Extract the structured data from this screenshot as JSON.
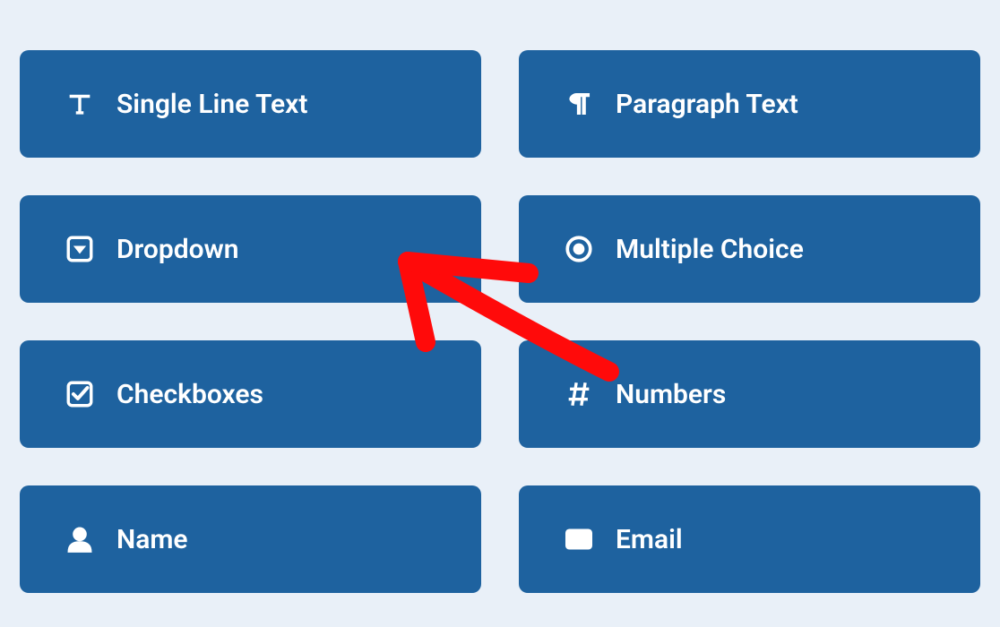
{
  "fields": [
    {
      "label": "Single Line Text",
      "icon": "text-cursor-icon"
    },
    {
      "label": "Paragraph Text",
      "icon": "paragraph-icon"
    },
    {
      "label": "Dropdown",
      "icon": "dropdown-icon"
    },
    {
      "label": "Multiple Choice",
      "icon": "radio-icon"
    },
    {
      "label": "Checkboxes",
      "icon": "checkbox-icon"
    },
    {
      "label": "Numbers",
      "icon": "hash-icon"
    },
    {
      "label": "Name",
      "icon": "user-icon"
    },
    {
      "label": "Email",
      "icon": "envelope-icon"
    }
  ],
  "colors": {
    "button_bg": "#1e629f",
    "page_bg": "#e9f0f8",
    "arrow": "#ff0a0a"
  }
}
